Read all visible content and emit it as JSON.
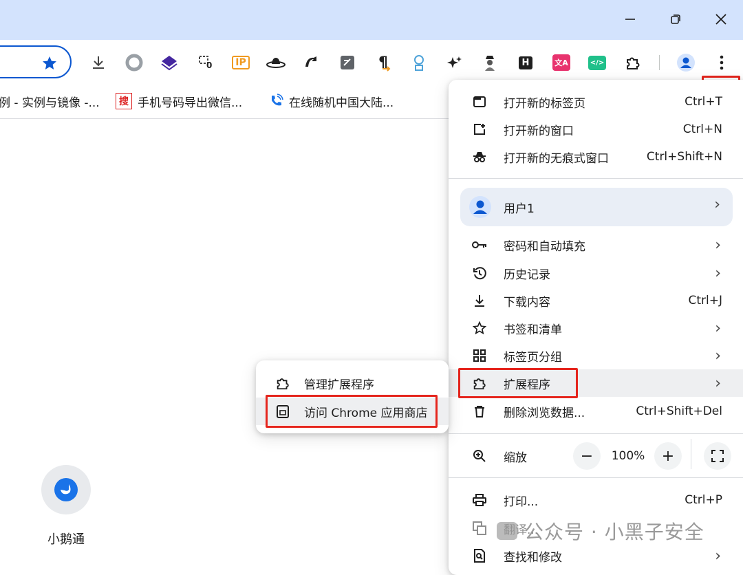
{
  "window": {
    "minimize_glyph": "—",
    "restore_glyph": "❐",
    "close_glyph": "✕"
  },
  "toolbar": {
    "extensions": [
      {
        "name": "download-icon"
      },
      {
        "name": "circle-extension-icon"
      },
      {
        "name": "layers-extension-icon"
      },
      {
        "name": "capture-extension-icon",
        "badge": "0"
      },
      {
        "name": "ip-extension-icon",
        "text": "IP"
      },
      {
        "name": "hat-extension-icon"
      },
      {
        "name": "loop-extension-icon"
      },
      {
        "name": "edit-extension-icon"
      },
      {
        "name": "paragraph-extension-icon",
        "text": "¶"
      },
      {
        "name": "robot-extension-icon"
      },
      {
        "name": "sparkle-extension-icon"
      },
      {
        "name": "spy-extension-icon"
      },
      {
        "name": "h-extension-icon",
        "text": "H"
      },
      {
        "name": "translate-extension-icon",
        "text": "文A"
      },
      {
        "name": "code-extension-icon",
        "text": "</>"
      },
      {
        "name": "puzzle-icon"
      }
    ]
  },
  "bookmarks": [
    {
      "label": "例 - 实例与镜像 -..."
    },
    {
      "label": "手机号码导出微信...",
      "icon_text": "搜"
    },
    {
      "label": "在线随机中国大陆..."
    }
  ],
  "page": {
    "app_label": "小鹅通"
  },
  "menu": {
    "items_top": [
      {
        "label": "打开新的标签页",
        "shortcut": "Ctrl+T",
        "icon": "new-tab-icon"
      },
      {
        "label": "打开新的窗口",
        "shortcut": "Ctrl+N",
        "icon": "new-window-icon"
      },
      {
        "label": "打开新的无痕式窗口",
        "shortcut": "Ctrl+Shift+N",
        "icon": "incognito-icon"
      }
    ],
    "profile": {
      "label": "用户1",
      "arrow": "›"
    },
    "items_mid": [
      {
        "label": "密码和自动填充",
        "arrow": "›",
        "icon": "key-icon"
      },
      {
        "label": "历史记录",
        "arrow": "›",
        "icon": "history-icon"
      },
      {
        "label": "下载内容",
        "shortcut": "Ctrl+J",
        "icon": "download-icon"
      },
      {
        "label": "书签和清单",
        "arrow": "›",
        "icon": "star-icon"
      },
      {
        "label": "标签页分组",
        "arrow": "›",
        "icon": "grid-icon"
      },
      {
        "label": "扩展程序",
        "arrow": "›",
        "icon": "puzzle-icon"
      },
      {
        "label": "删除浏览数据...",
        "shortcut": "Ctrl+Shift+Del",
        "icon": "trash-icon"
      }
    ],
    "zoom": {
      "label": "缩放",
      "minus": "−",
      "value": "100%",
      "plus": "+"
    },
    "items_bottom": [
      {
        "label": "打印...",
        "shortcut": "Ctrl+P",
        "icon": "print-icon"
      },
      {
        "label": "翻译...",
        "icon": "translate-icon"
      },
      {
        "label": "查找和修改",
        "arrow": "›",
        "icon": "search-doc-icon"
      }
    ]
  },
  "submenu": {
    "items": [
      {
        "label": "管理扩展程序",
        "icon": "puzzle-icon"
      },
      {
        "label": "访问 Chrome 应用商店",
        "icon": "store-icon"
      }
    ]
  },
  "watermark": {
    "text": "公众号 · 小黑子安全"
  },
  "colors": {
    "accent": "#0b57d0",
    "highlight": "#e5251d",
    "titlebar": "#d3e3fd"
  }
}
